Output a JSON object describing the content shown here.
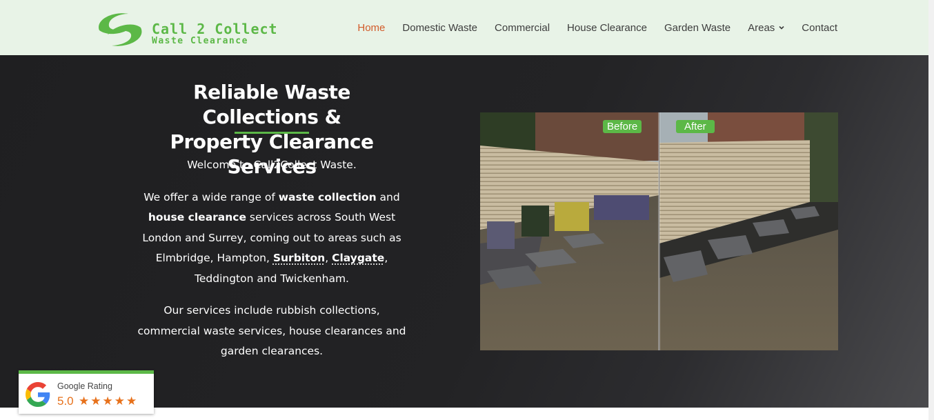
{
  "brand": {
    "title": "Call 2 Collect",
    "subtitle": "Waste Clearance",
    "color": "#5cb847"
  },
  "nav": {
    "items": [
      {
        "label": "Home",
        "active": true
      },
      {
        "label": "Domestic Waste"
      },
      {
        "label": "Commercial"
      },
      {
        "label": "House Clearance"
      },
      {
        "label": "Garden Waste"
      },
      {
        "label": "Areas",
        "has_dropdown": true
      },
      {
        "label": "Contact"
      }
    ],
    "active_color": "#d25b2a"
  },
  "hero": {
    "title_line1": "Reliable Waste Collections &",
    "title_line2": "Property Clearance Services",
    "welcome": "Welcome to Call2Collect Waste.",
    "p2_a": "We offer a wide range of ",
    "p2_b": "waste collection",
    "p2_c": " and ",
    "p2_d": "house clearance",
    "p2_e": " services across South West London and Surrey, coming out to areas such as Elmbridge, Hampton, ",
    "p2_link1": "Surbiton",
    "p2_sep": ", ",
    "p2_link2": "Claygate",
    "p2_f": ", Teddington and Twickenham.",
    "p3": "Our services include rubbish collections, commercial waste services, house clearances and garden clearances."
  },
  "photo": {
    "before_label": "Before",
    "after_label": "After"
  },
  "google_badge": {
    "label": "Google Rating",
    "score": "5.0",
    "stars": "★★★★★",
    "star_count": 5
  }
}
